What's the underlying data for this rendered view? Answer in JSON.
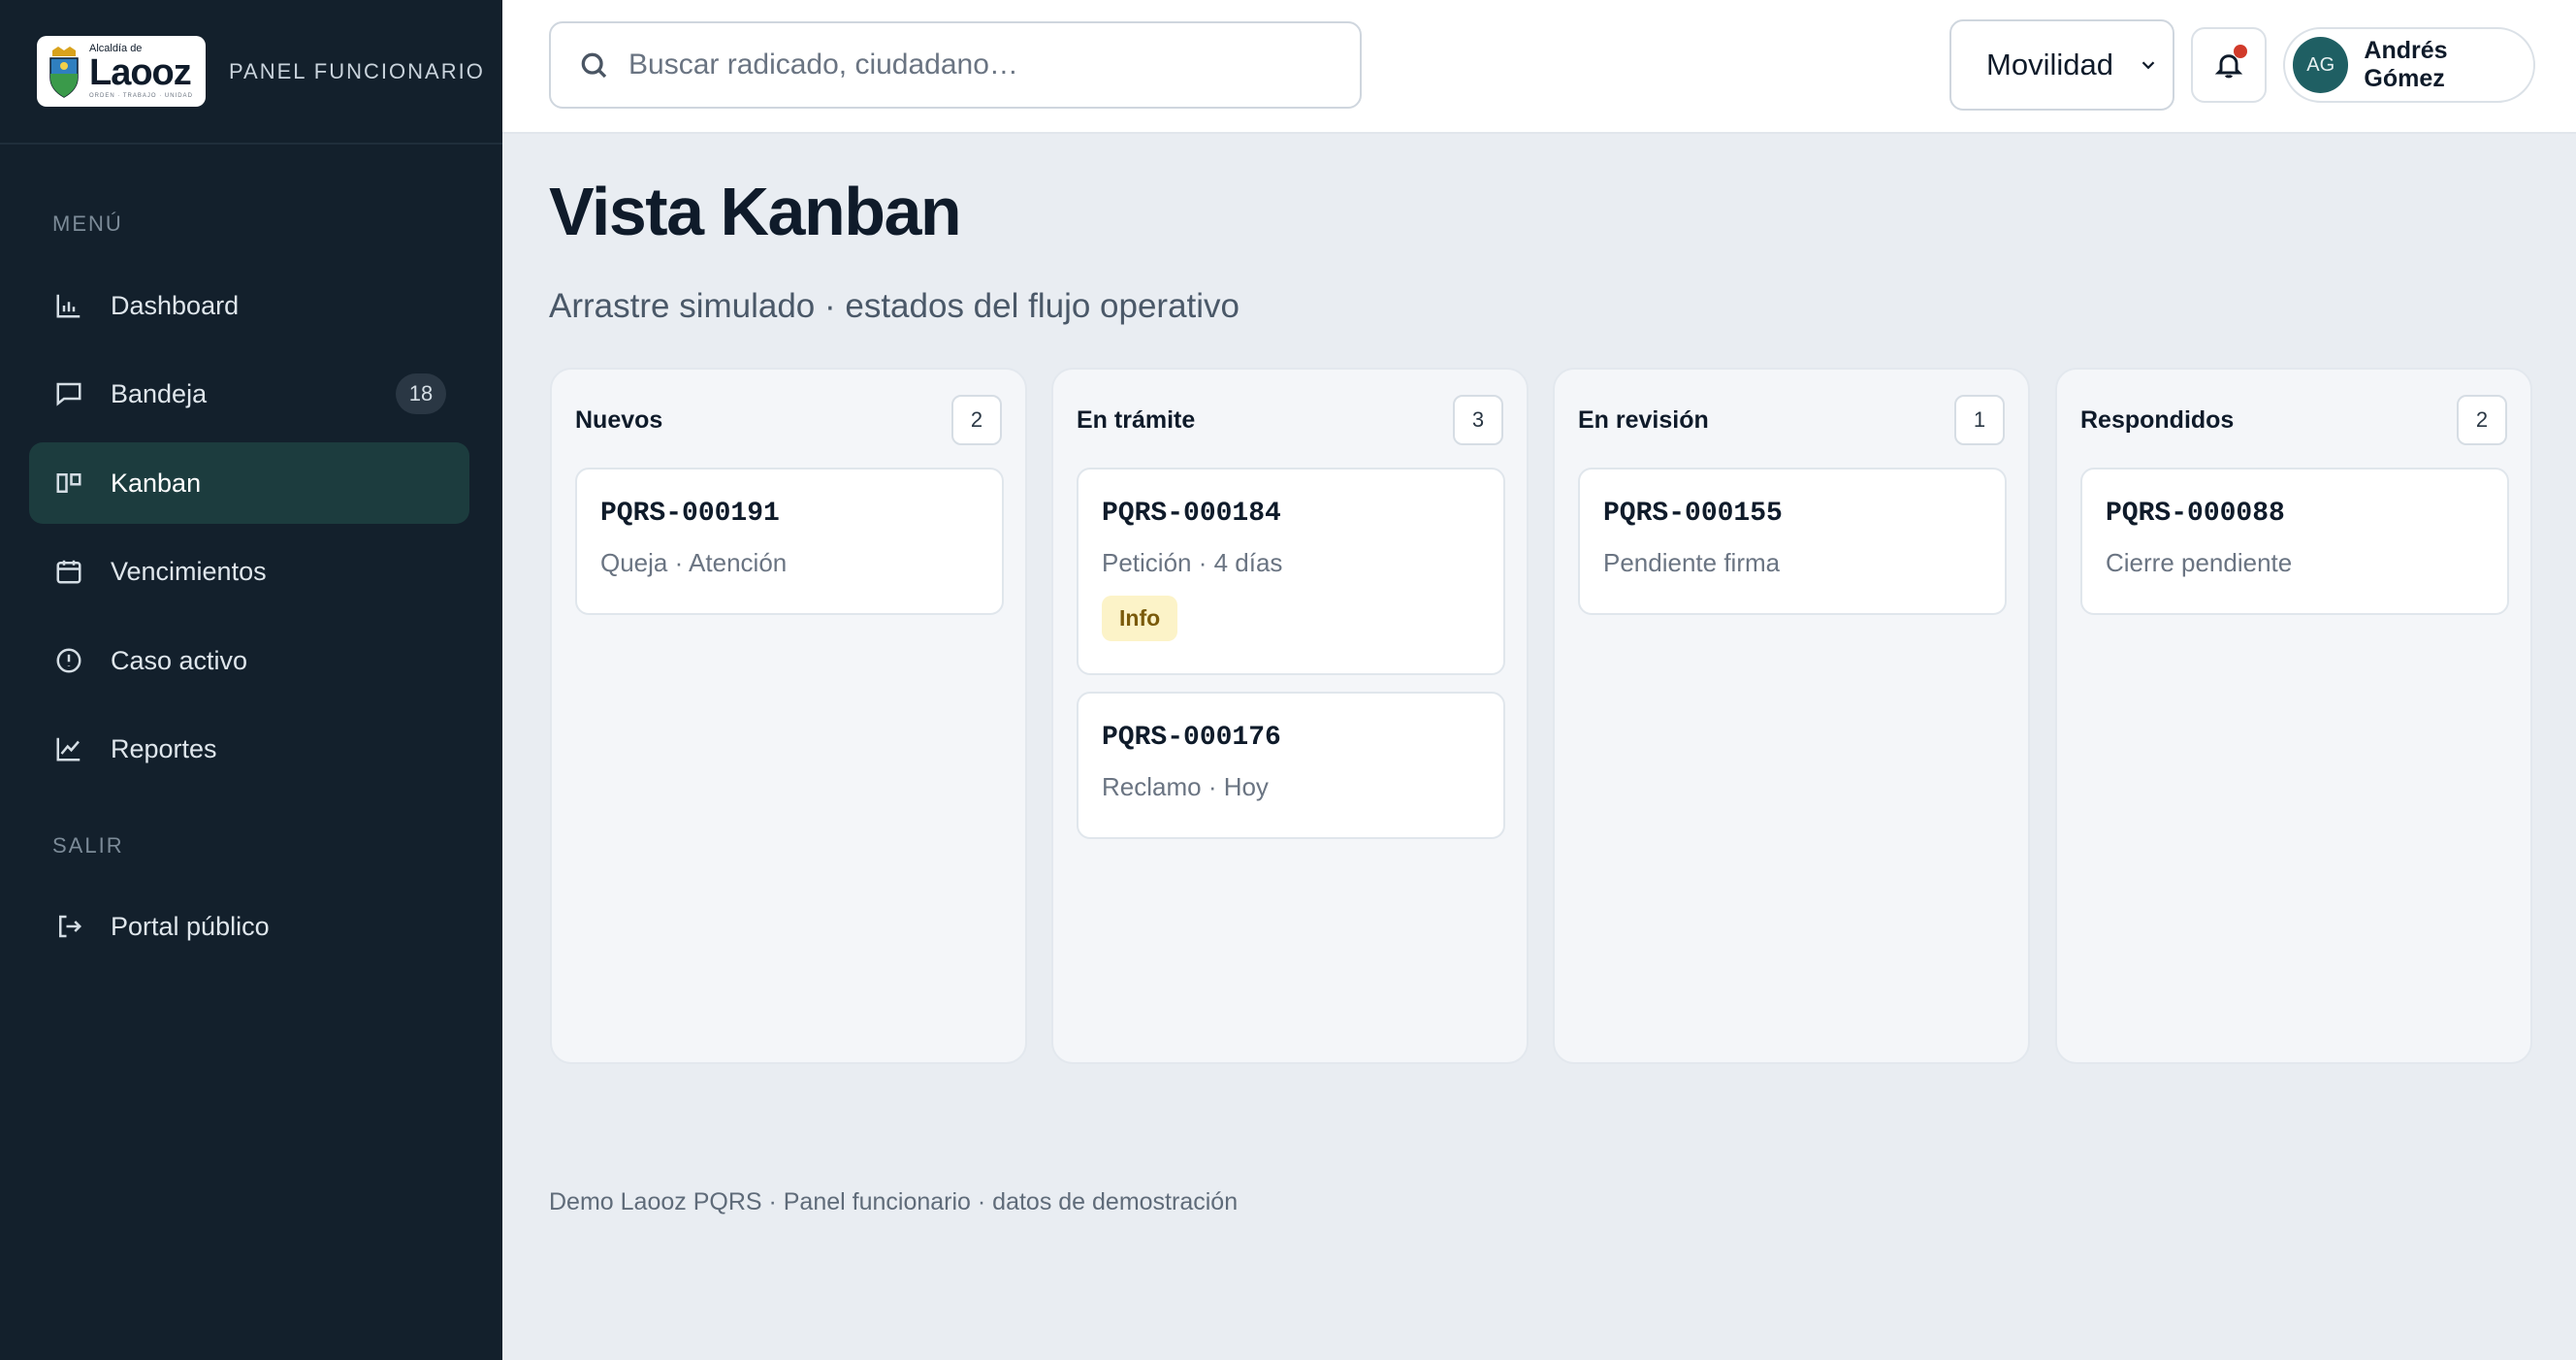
{
  "brand": {
    "logo_small": "Alcaldía de",
    "logo_name": "Laooz",
    "logo_tagline": "ORDEN · TRABAJO · UNIDAD",
    "panel_label": "PANEL FUNCIONARIO"
  },
  "sidebar": {
    "menu_label": "MENÚ",
    "items": [
      {
        "label": "Dashboard",
        "icon": "bar-chart-icon"
      },
      {
        "label": "Bandeja",
        "icon": "inbox-icon",
        "badge": "18"
      },
      {
        "label": "Kanban",
        "icon": "kanban-icon",
        "active": true
      },
      {
        "label": "Vencimientos",
        "icon": "calendar-icon"
      },
      {
        "label": "Caso activo",
        "icon": "alert-circle-icon"
      },
      {
        "label": "Reportes",
        "icon": "line-chart-icon"
      }
    ],
    "exit_label": "SALIR",
    "exit_items": [
      {
        "label": "Portal público",
        "icon": "logout-icon"
      }
    ]
  },
  "topbar": {
    "search_placeholder": "Buscar radicado, ciudadano…",
    "department": "Movilidad",
    "user_initials": "AG",
    "user_name": "Andrés Gómez"
  },
  "page": {
    "title": "Vista Kanban",
    "subtitle": "Arrastre simulado · estados del flujo operativo"
  },
  "columns": [
    {
      "title": "Nuevos",
      "count": "2",
      "cards": [
        {
          "id": "PQRS-000191",
          "meta": "Queja · Atención"
        }
      ]
    },
    {
      "title": "En trámite",
      "count": "3",
      "cards": [
        {
          "id": "PQRS-000184",
          "meta": "Petición · 4 días",
          "tag": "Info"
        },
        {
          "id": "PQRS-000176",
          "meta": "Reclamo · Hoy"
        }
      ]
    },
    {
      "title": "En revisión",
      "count": "1",
      "cards": [
        {
          "id": "PQRS-000155",
          "meta": "Pendiente firma"
        }
      ]
    },
    {
      "title": "Respondidos",
      "count": "2",
      "cards": [
        {
          "id": "PQRS-000088",
          "meta": "Cierre pendiente"
        }
      ]
    }
  ],
  "footer": "Demo Laooz PQRS · Panel funcionario · datos de demostración",
  "colors": {
    "sidebar_bg": "#13202c",
    "active_item_bg": "#1c3c3e",
    "avatar_bg": "#1f5f63",
    "notification_dot": "#d13a2a",
    "info_tag_bg": "#fcf3c8"
  }
}
